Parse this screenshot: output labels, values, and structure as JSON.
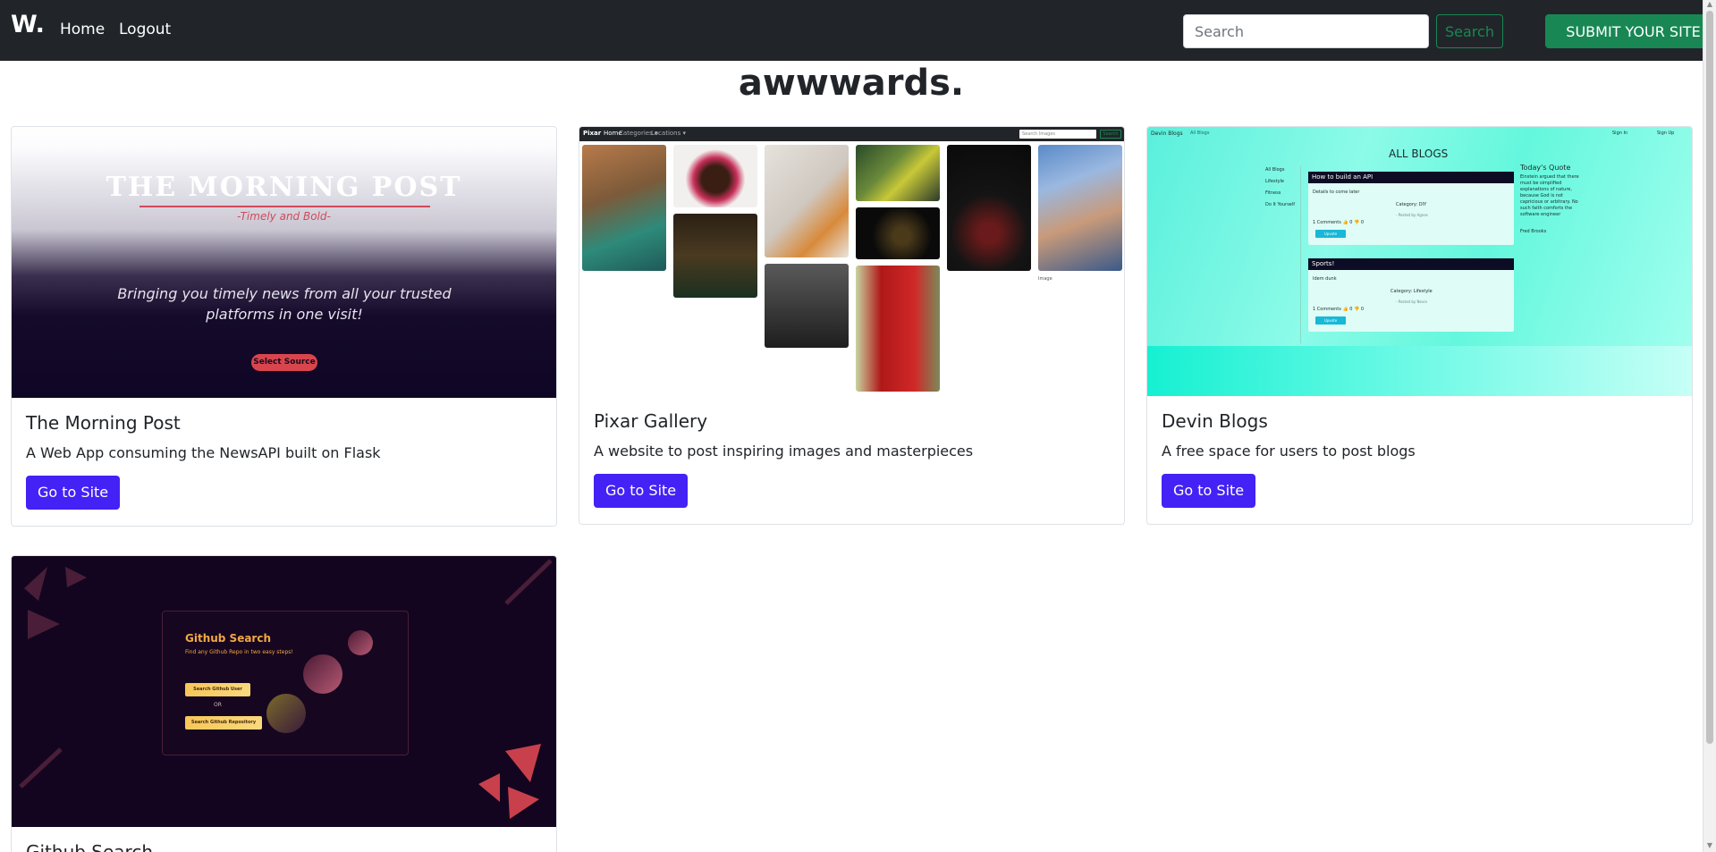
{
  "navbar": {
    "brand": "W.",
    "links": [
      "Home",
      "Logout"
    ],
    "search_placeholder": "Search",
    "search_button": "Search",
    "submit_button": "SUBMIT YOUR SITE"
  },
  "page_title": "awwwards.",
  "cards": [
    {
      "title": "The Morning Post",
      "description": "A Web App consuming the NewsAPI built on Flask",
      "button": "Go to Site",
      "thumbnail": {
        "heading": "THE MORNING POST",
        "subheading": "-Timely and Bold-",
        "tagline": "Bringing you timely news from all your trusted platforms in one visit!",
        "button": "Select Source"
      }
    },
    {
      "title": "Pixar Gallery",
      "description": "A website to post inspiring images and masterpieces",
      "button": "Go to Site",
      "thumbnail": {
        "brand": "Pixar",
        "nav": [
          "Home",
          "Categories ▾",
          "Locations ▾"
        ],
        "search_placeholder": "Search Images",
        "search_button": "Search",
        "broken_image_alt": "Image"
      }
    },
    {
      "title": "Devin Blogs",
      "description": "A free space for users to post blogs",
      "button": "Go to Site",
      "thumbnail": {
        "brand": "Devin Blogs",
        "nav": "All Blogs",
        "sign_in": "Sign In",
        "sign_up": "Sign Up",
        "heading": "ALL BLOGS",
        "sidebar": [
          "All Blogs",
          "Lifestyle",
          "Fitness",
          "Do It Yourself"
        ],
        "posts": [
          {
            "title": "How to build an API",
            "body": "Details to come later",
            "category": "Category: DIY",
            "author": "- Posted by Agnes",
            "meta": "1 Comments 👍 0 👎 0",
            "button": "Upvote"
          },
          {
            "title": "Sports!",
            "body": "Idem dunk",
            "category": "Category: Lifestyle",
            "author": "- Posted by Nevin",
            "meta": "1 Comments 👍 0 👎 0",
            "button": "Upvote"
          }
        ],
        "quote_heading": "Today's Quote",
        "quote": "Einstein argued that there must be simplified explanations of nature, because God is not capricious or arbitrary. No such faith comforts the software engineer",
        "quote_author": "Fred Brooks"
      }
    },
    {
      "title": "Github Search",
      "thumbnail": {
        "heading": "Github Search",
        "subheading": "Find any Github Repo in two easy steps!",
        "button_user": "Search Github User",
        "or_text": "OR",
        "button_repo": "Search Github Repository"
      }
    }
  ],
  "colors": {
    "navbar_bg": "#212529",
    "success": "#198754",
    "card_button": "#4421f5",
    "morning_post_dark": "#0f0525",
    "github_bg": "#13051f"
  }
}
